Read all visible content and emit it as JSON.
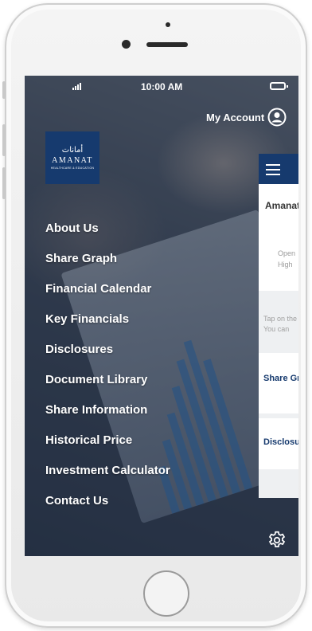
{
  "status_bar": {
    "time": "10:00 AM"
  },
  "account": {
    "label": "My Account"
  },
  "logo": {
    "arabic": "أمانات",
    "name": "AMANAT",
    "tagline": "HEALTHCARE & EDUCATION"
  },
  "menu": {
    "items": [
      {
        "label": "About Us"
      },
      {
        "label": "Share Graph"
      },
      {
        "label": "Financial Calendar"
      },
      {
        "label": "Key Financials"
      },
      {
        "label": "Disclosures"
      },
      {
        "label": "Document Library"
      },
      {
        "label": "Share Information"
      },
      {
        "label": "Historical Price"
      },
      {
        "label": "Investment Calculator"
      },
      {
        "label": "Contact Us"
      }
    ]
  },
  "panel": {
    "title": "Amanat",
    "open_label": "Open",
    "high_label": "High",
    "tap_hint": "Tap on the",
    "can_hint": "You can",
    "share_graph": "Share Graph",
    "disclosures": "Disclosures"
  },
  "colors": {
    "brand_navy": "#163a6e",
    "menu_text": "#ffffff"
  },
  "icons": {
    "account": "user-circle-icon",
    "settings": "gear-icon",
    "menu": "hamburger-icon"
  }
}
